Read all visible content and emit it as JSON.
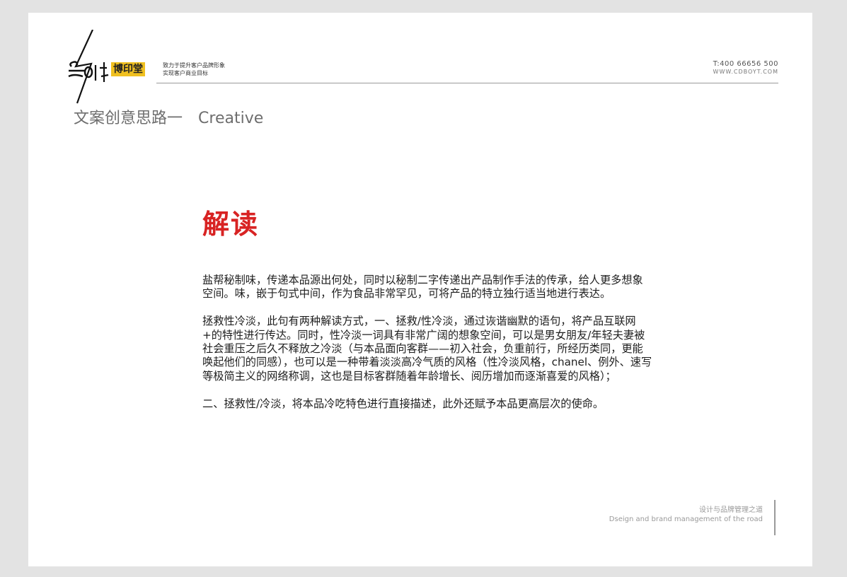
{
  "header": {
    "brand_name": "博印堂",
    "slogan_line1": "致力于提升客户品牌形象",
    "slogan_line2": "实现客户商业目标",
    "phone": "T:400 66656 500",
    "website": "WWW.CDBOYT.COM"
  },
  "section": {
    "title_cn": "文案创意思路一",
    "title_en": "Creative"
  },
  "content": {
    "heading": "解读",
    "paragraphs": [
      "盐帮秘制味，传递本品源出何处，同时以秘制二字传递出产品制作手法的传承，给人更多想象空间。味，嵌于句式中间，作为食品非常罕见，可将产品的特立独行适当地进行表达。",
      "拯救性冷淡，此句有两种解读方式，一、拯救/性冷淡，通过诙谐幽默的语句，将产品互联网+的特性进行传达。同时，性冷淡一词具有非常广阔的想象空间，可以是男女朋友/年轻夫妻被社会重压之后久不释放之冷淡（与本品面向客群——初入社会，负重前行，所经历类同，更能唤起他们的同感），也可以是一种带着淡淡高冷气质的风格（性冷淡风格，chanel、例外、速写等极简主义的网络称调，这也是目标客群随着年龄增长、阅历增加而逐渐喜爱的风格）；",
      "二、拯救性/冷淡，将本品冷吃特色进行直接描述，此外还赋予本品更高层次的使命。"
    ]
  },
  "footer": {
    "line_cn": "设计与品牌管理之道",
    "line_en": "Dseign and brand management of the road"
  },
  "colors": {
    "heading_red": "#d82323",
    "brand_yellow": "#f0c020",
    "page_background": "#e3e3e3"
  }
}
